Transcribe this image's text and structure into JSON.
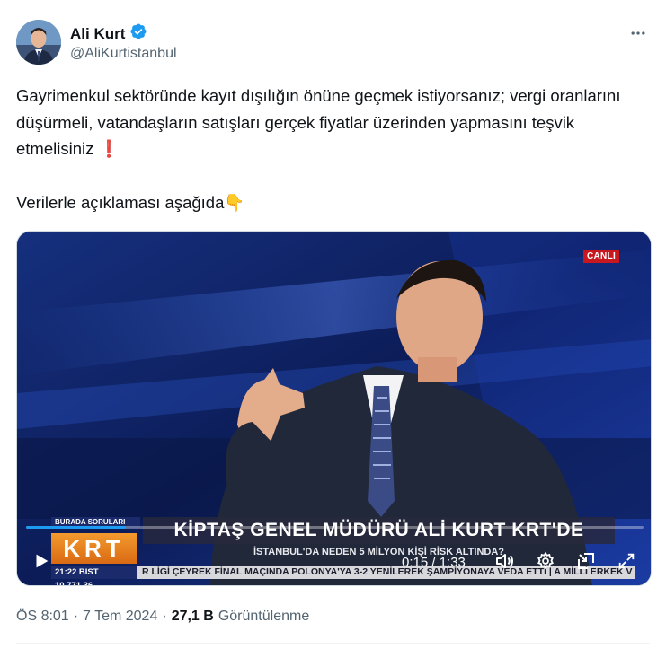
{
  "author": {
    "name": "Ali Kurt",
    "handle": "@AliKurtistanbul",
    "verified": true
  },
  "tweet": {
    "paragraph1": "Gayrimenkul sektöründe kayıt dışılığın önüne geçmek istiyorsanız; vergi oranlarını düşürmeli, vatandaşların satışları gerçek fiyatlar üzerinden yapmasını teşvik etmelisiniz",
    "paragraph1_emoji": "❗",
    "paragraph2": "Verilerle açıklaması aşağıda",
    "paragraph2_emoji": "👇"
  },
  "video": {
    "live_badge": "CANLI",
    "lower_third": {
      "tag": "BURADA SORULARI",
      "logo": "KRT",
      "title": "KİPTAŞ GENEL MÜDÜRÜ ALİ KURT KRT'DE",
      "subtitle": "İSTANBUL'DA NEDEN 5 MİLYON KİŞİ RİSK ALTINDA?",
      "ticker_time": "21:22  BIST 10.771,36",
      "ticker_text": "R LİGİ ÇEYREK FİNAL MAÇINDA POLONYA'YA 3-2 YENİLEREK ŞAMPİYONAYA VEDA ETTİ  |  A MİLLİ ERKEK V"
    },
    "time_readout": "0:15 / 1:33",
    "progress": 0.161,
    "icons": {
      "play": "play-icon",
      "volume": "volume-icon",
      "settings": "settings-icon",
      "pip": "picture-in-picture-icon",
      "fullscreen": "fullscreen-icon"
    }
  },
  "meta": {
    "time": "ÖS 8:01",
    "separator": "·",
    "date": "7 Tem 2024",
    "views_count": "27,1 B",
    "views_label": "Görüntülenme"
  },
  "colors": {
    "accent": "#1d9bf0",
    "live": "#c8181f",
    "logo_orange": "#f39a2d"
  }
}
